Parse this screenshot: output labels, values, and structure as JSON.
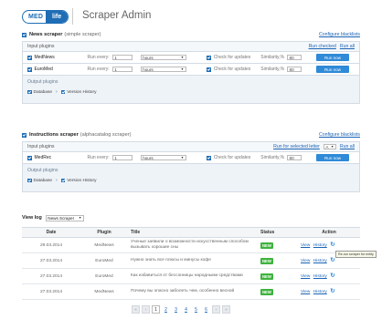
{
  "header": {
    "logo_left": "MED",
    "logo_right": "life",
    "title": "Scraper Admin"
  },
  "scrapers": [
    {
      "name": "News scraper",
      "sub": "(simple scraper)",
      "configure_blacklists": "Configure blacklists",
      "input_label": "Input plugins",
      "run_checked": "Run checked",
      "run_all": "Run all",
      "plugins": [
        {
          "name": "MedNews",
          "run_every_label": "Run every:",
          "interval": "1",
          "unit": "hours",
          "check_label": "Check for updates",
          "similarity_label": "Similarity,%",
          "similarity": "80",
          "run_now": "Run now"
        },
        {
          "name": "EuroMed",
          "run_every_label": "Run every:",
          "interval": "1",
          "unit": "hours",
          "check_label": "Check for updates",
          "similarity_label": "Similarity,%",
          "similarity": "80",
          "run_now": "Run now"
        }
      ],
      "output_label": "Output plugins",
      "output_items": [
        "Database",
        "Version History"
      ]
    },
    {
      "name": "Instructions scraper",
      "sub": "(alphacatalog scraper)",
      "configure_blacklists": "Configure blacklists",
      "input_label": "Input plugins",
      "run_selected": "Run for selected letter",
      "letter": "A",
      "run_all": "Run all",
      "plugins": [
        {
          "name": "MedRec",
          "run_every_label": "Run every:",
          "interval": "1",
          "unit": "hours",
          "check_label": "Check for updates",
          "similarity_label": "Similarity,%",
          "similarity": "80",
          "run_now": "Run now"
        }
      ],
      "output_label": "Output plugins",
      "output_items": [
        "Database",
        "Version History"
      ]
    }
  ],
  "view_log": {
    "label": "View log",
    "selected": "News Scraper"
  },
  "log_table": {
    "headers": [
      "Date",
      "Plugin",
      "Title",
      "Status",
      "Action"
    ],
    "rows": [
      {
        "date": "29.03.2014",
        "plugin": "MedNews",
        "title": "Ученые заявили о возможности искусственным способом вызывать хорошие сны",
        "status": "NEW",
        "view": "View",
        "history": "History"
      },
      {
        "date": "27.03.2014",
        "plugin": "EuroMed",
        "title": "Нужно знать все плюсы и минусы кофе",
        "status": "NEW",
        "view": "View",
        "history": "History"
      },
      {
        "date": "27.03.2014",
        "plugin": "EuroMed",
        "title": "Как избавиться от бессонницы народными средствами",
        "status": "NEW",
        "view": "View",
        "history": "History"
      },
      {
        "date": "27.03.2014",
        "plugin": "MedNews",
        "title": "Почему вы опасно заболеть чем, особенно весной",
        "status": "NEW",
        "view": "View",
        "history": "History"
      }
    ],
    "tooltip": "Re-run scraper for entity"
  },
  "pagination": {
    "first": "«",
    "prev": "‹",
    "pages": [
      "1",
      "2",
      "3",
      "4",
      "5",
      "6"
    ],
    "current": "1",
    "next": "›",
    "last": "»"
  },
  "colors": {
    "brand": "#1e6db5",
    "button": "#2f8ad8",
    "status_new": "#3eb33e",
    "link": "#1a63b5"
  }
}
